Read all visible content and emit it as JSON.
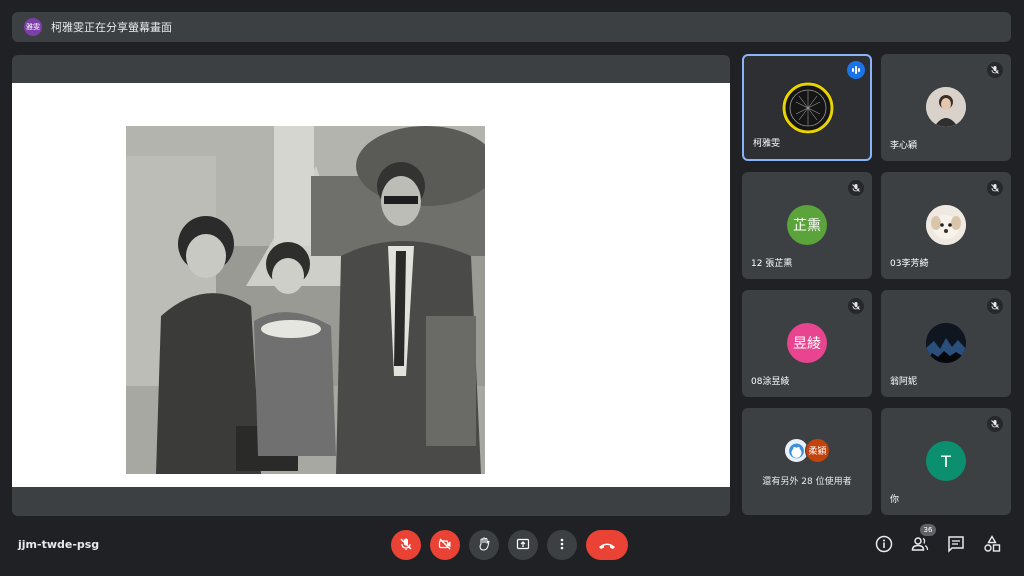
{
  "banner": {
    "avatar_text": "雅雯",
    "text": "柯雅雯正在分享螢幕畫面"
  },
  "tiles": [
    {
      "name": "柯雅雯",
      "speaking": true
    },
    {
      "name": "李心穎"
    },
    {
      "name": "12 張芷熏",
      "initials": "芷熏",
      "color": "#5ba33b"
    },
    {
      "name": "03李芳綺"
    },
    {
      "name": "08涂昱綾",
      "initials": "昱綾",
      "color": "#e8448f"
    },
    {
      "name": "翁阿妮"
    },
    {
      "others_text": "還有另外 28 位使用者",
      "initials": "柔穎"
    },
    {
      "name": "你",
      "initials": "T",
      "color": "#0b8f6e"
    }
  ],
  "meeting_code": "jjm-twde-psg",
  "participant_count": "36",
  "icons": [
    "mic-off-icon",
    "camera-off-icon",
    "raise-hand-icon",
    "present-icon",
    "more-icon",
    "hang-up-icon",
    "info-icon",
    "people-icon",
    "chat-icon",
    "activities-icon"
  ]
}
